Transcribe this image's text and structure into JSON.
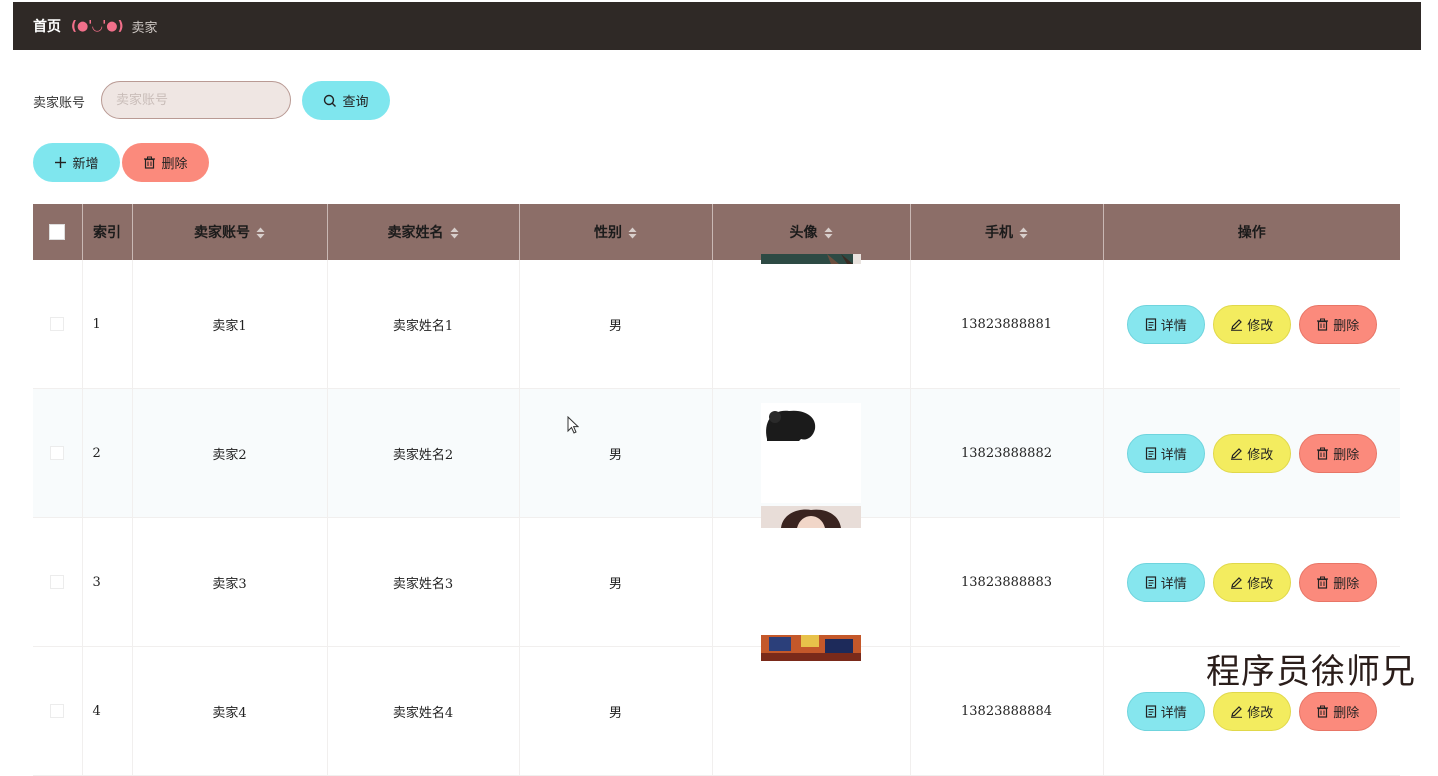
{
  "breadcrumb": {
    "home": "首页",
    "separator": "(●'◡'●)",
    "current": "卖家"
  },
  "search": {
    "label": "卖家账号",
    "placeholder": "卖家账号",
    "value": "",
    "query_label": "查询"
  },
  "actions": {
    "add_label": "新增",
    "delete_label": "删除"
  },
  "table": {
    "columns": [
      "索引",
      "卖家账号",
      "卖家姓名",
      "性别",
      "头像",
      "手机",
      "操作"
    ],
    "rows": [
      {
        "index": "1",
        "account": "卖家1",
        "name": "卖家姓名1",
        "gender": "男",
        "phone": "13823888881"
      },
      {
        "index": "2",
        "account": "卖家2",
        "name": "卖家姓名2",
        "gender": "男",
        "phone": "13823888882"
      },
      {
        "index": "3",
        "account": "卖家3",
        "name": "卖家姓名3",
        "gender": "男",
        "phone": "13823888883"
      },
      {
        "index": "4",
        "account": "卖家4",
        "name": "卖家姓名4",
        "gender": "男",
        "phone": "13823888884"
      }
    ],
    "row_actions": {
      "detail": "详情",
      "edit": "修改",
      "delete": "删除"
    }
  },
  "watermark": "程序员徐师兄",
  "colors": {
    "topbar": "#2f2926",
    "header": "#8c6e68",
    "cyan": "#7fe6ee",
    "yellow": "#f3ec5f",
    "red": "#fb8a7c"
  }
}
